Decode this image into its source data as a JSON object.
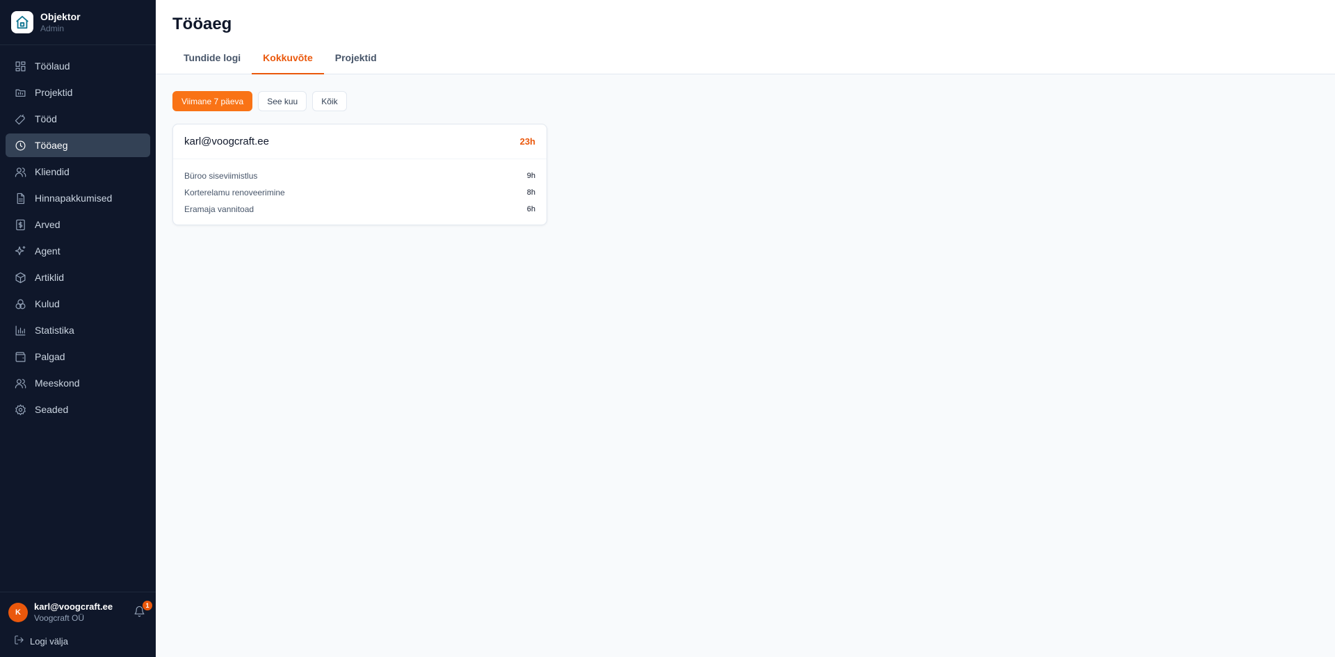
{
  "app": {
    "name": "Objektor",
    "role": "Admin"
  },
  "sidebar": {
    "items": [
      {
        "label": "Töölaud",
        "icon": "dashboard-icon"
      },
      {
        "label": "Projektid",
        "icon": "folder-icon"
      },
      {
        "label": "Tööd",
        "icon": "wrench-icon"
      },
      {
        "label": "Tööaeg",
        "icon": "clock-icon"
      },
      {
        "label": "Kliendid",
        "icon": "users-icon"
      },
      {
        "label": "Hinnapakkumised",
        "icon": "document-icon"
      },
      {
        "label": "Arved",
        "icon": "invoice-icon"
      },
      {
        "label": "Agent",
        "icon": "sparkles-icon"
      },
      {
        "label": "Artiklid",
        "icon": "box-icon"
      },
      {
        "label": "Kulud",
        "icon": "coins-icon"
      },
      {
        "label": "Statistika",
        "icon": "bar-chart-icon"
      },
      {
        "label": "Palgad",
        "icon": "wallet-icon"
      },
      {
        "label": "Meeskond",
        "icon": "team-icon"
      },
      {
        "label": "Seaded",
        "icon": "gear-icon"
      }
    ],
    "active_index": 3
  },
  "user": {
    "initial": "K",
    "email": "karl@voogcraft.ee",
    "company": "Voogcraft OÜ",
    "notifications": "1",
    "logout_label": "Logi välja"
  },
  "page": {
    "title": "Tööaeg",
    "tabs": [
      "Tundide logi",
      "Kokkuvõte",
      "Projektid"
    ],
    "active_tab": 1
  },
  "filters": [
    "Viimane 7 päeva",
    "See kuu",
    "Kõik"
  ],
  "summary": {
    "user": "karl@voogcraft.ee",
    "total": "23h",
    "rows": [
      {
        "project": "Büroo siseviimistlus",
        "hours": "9h"
      },
      {
        "project": "Korterelamu renoveerimine",
        "hours": "8h"
      },
      {
        "project": "Eramaja vannitoad",
        "hours": "6h"
      }
    ]
  },
  "colors": {
    "accent": "#ea580c",
    "sidebar_bg": "#0f172a",
    "active_nav_bg": "#334155"
  }
}
